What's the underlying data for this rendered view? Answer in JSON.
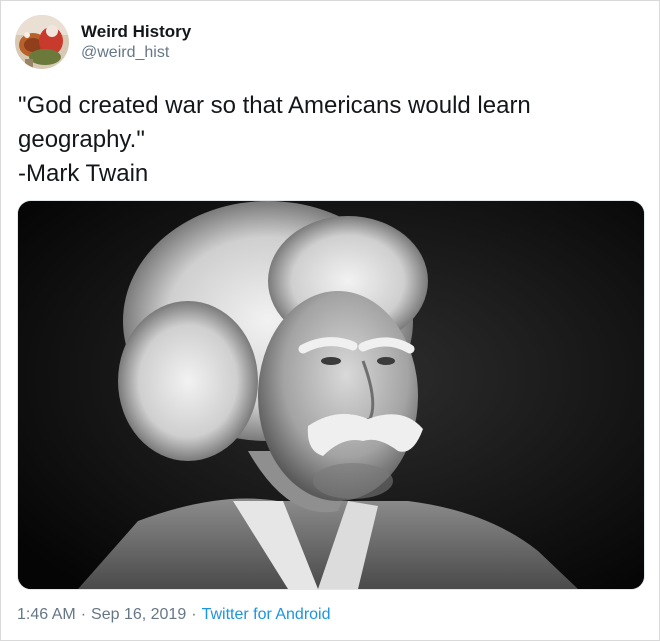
{
  "author": {
    "display_name": "Weird History",
    "handle": "@weird_hist"
  },
  "tweet": {
    "text": "\"God created war so that Americans would learn\ngeography.\"\n-Mark Twain"
  },
  "meta": {
    "time": "1:46 AM",
    "separator": "·",
    "date": "Sep 16, 2019",
    "source": "Twitter for Android"
  },
  "colors": {
    "name": "#14171a",
    "secondary": "#657786",
    "link": "#1b95e0"
  }
}
